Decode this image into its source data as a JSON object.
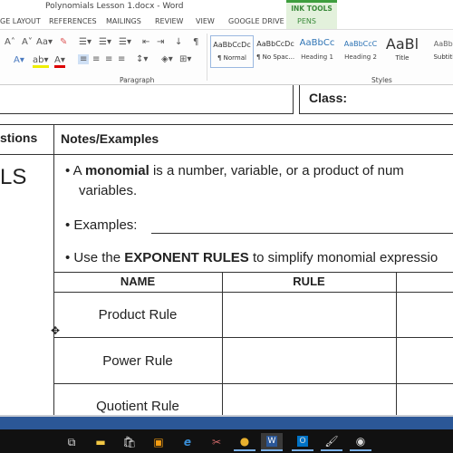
{
  "window": {
    "title": "Polynomials Lesson 1.docx - Word"
  },
  "tabs": [
    "GE LAYOUT",
    "REFERENCES",
    "MAILINGS",
    "REVIEW",
    "VIEW",
    "GOOGLE DRIVE",
    "PENS"
  ],
  "ink_tools_label": "INK TOOLS",
  "ribbon": {
    "groups": [
      "Paragraph",
      "Styles"
    ],
    "styles": [
      {
        "preview": "AaBbCcDc",
        "name": "¶ Normal"
      },
      {
        "preview": "AaBbCcDc",
        "name": "¶ No Spac..."
      },
      {
        "preview": "AaBbCc",
        "name": "Heading 1"
      },
      {
        "preview": "AaBbCcC",
        "name": "Heading 2"
      },
      {
        "preview": "AaBl",
        "name": "Title"
      },
      {
        "preview": "AaBbC",
        "name": "Subtitle"
      }
    ]
  },
  "document": {
    "class_label": "Class:",
    "col_questions": "stions",
    "col_notes": "Notes/Examples",
    "left_title": "LS",
    "bullet1_pre": "A ",
    "bullet1_bold": "monomial",
    "bullet1_post": " is a number, variable, or a product of num",
    "bullet1_line2": "variables.",
    "bullet2": "Examples:",
    "bullet3_pre": "Use the ",
    "bullet3_bold": "EXPONENT RULES",
    "bullet3_post": " to simplify monomial expressio",
    "table": {
      "headers": [
        "NAME",
        "RULE",
        ""
      ],
      "rows": [
        "Product Rule",
        "Power Rule",
        "Quotient Rule"
      ]
    }
  },
  "taskbar": {
    "icons": [
      "task-view-icon",
      "file-explorer-icon",
      "store-icon",
      "media-player-icon",
      "edge-icon",
      "snipping-tool-icon",
      "chrome-icon",
      "word-icon",
      "outlook-icon",
      "paint-icon",
      "cortana-icon"
    ]
  },
  "colors": {
    "status_bar": "#2b5797",
    "ink_tools": "#3e9e3e",
    "taskbar": "#111111"
  }
}
